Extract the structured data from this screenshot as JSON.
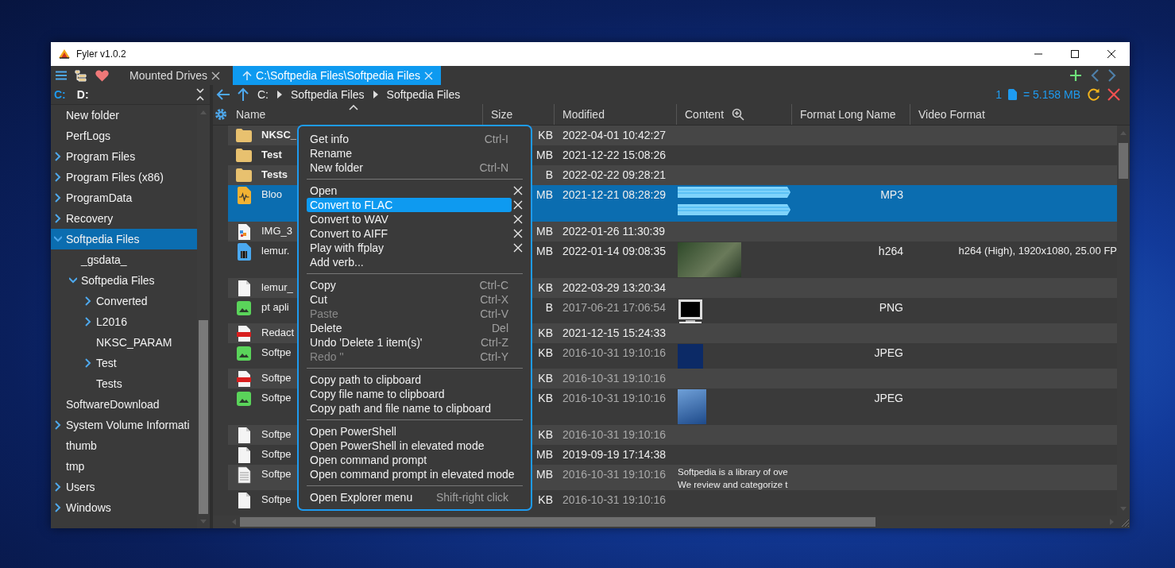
{
  "window": {
    "title": "Fyler v1.0.2"
  },
  "tabs": [
    {
      "label": "Mounted Drives",
      "selected": false
    },
    {
      "label": "C:\\Softpedia Files\\Softpedia Files",
      "selected": true
    }
  ],
  "drives": [
    {
      "label": "C:",
      "selected": true
    },
    {
      "label": "D:",
      "selected": false
    }
  ],
  "breadcrumb": [
    "C:",
    "Softpedia Files",
    "Softpedia Files"
  ],
  "selection_summary": {
    "count": "1",
    "size": "= 5.158 MB"
  },
  "tree": [
    {
      "label": "New folder",
      "expandable": false,
      "selected": false
    },
    {
      "label": "PerfLogs",
      "expandable": false,
      "selected": false
    },
    {
      "label": "Program Files",
      "expandable": true,
      "expanded": false,
      "selected": false
    },
    {
      "label": "Program Files (x86)",
      "expandable": true,
      "expanded": false,
      "selected": false
    },
    {
      "label": "ProgramData",
      "expandable": true,
      "expanded": false,
      "selected": false
    },
    {
      "label": "Recovery",
      "expandable": true,
      "expanded": false,
      "selected": false
    },
    {
      "label": "Softpedia Files",
      "expandable": true,
      "expanded": true,
      "selected": true,
      "children": [
        {
          "label": "_gsdata_",
          "expandable": false,
          "selected": false
        },
        {
          "label": "Softpedia Files",
          "expandable": true,
          "expanded": true,
          "selected": false,
          "children": [
            {
              "label": "Converted",
              "expandable": true,
              "expanded": false,
              "selected": false
            },
            {
              "label": "L2016",
              "expandable": true,
              "expanded": false,
              "selected": false
            },
            {
              "label": "NKSC_PARAM",
              "expandable": false,
              "selected": false
            },
            {
              "label": "Test",
              "expandable": true,
              "expanded": false,
              "selected": false
            },
            {
              "label": "Tests",
              "expandable": false,
              "selected": false
            }
          ]
        }
      ]
    },
    {
      "label": "SoftwareDownload",
      "expandable": false,
      "selected": false
    },
    {
      "label": "System Volume Informati",
      "expandable": true,
      "expanded": false,
      "selected": false
    },
    {
      "label": "thumb",
      "expandable": false,
      "selected": false
    },
    {
      "label": "tmp",
      "expandable": false,
      "selected": false
    },
    {
      "label": "Users",
      "expandable": true,
      "expanded": false,
      "selected": false
    },
    {
      "label": "Windows",
      "expandable": true,
      "expanded": false,
      "selected": false
    }
  ],
  "columns": [
    {
      "label": "Name",
      "kind": "plain"
    },
    {
      "label": "Size",
      "kind": "plain"
    },
    {
      "label": "Modified",
      "kind": "plain"
    },
    {
      "label": "Content",
      "kind": "zoomable"
    },
    {
      "label": "Format Long Name",
      "kind": "plain"
    },
    {
      "label": "Video Format",
      "kind": "plain"
    }
  ],
  "rows": [
    {
      "kind": "folder",
      "name": "NKSC_",
      "size": "KB",
      "modified": "2022-04-01 10:42:27",
      "dimmed": false,
      "selected": false
    },
    {
      "kind": "folder",
      "name": "Test",
      "size": "MB",
      "modified": "2021-12-22 15:08:26",
      "dimmed": false,
      "selected": false
    },
    {
      "kind": "folder",
      "name": "Tests",
      "size": "B",
      "modified": "2022-02-22 09:28:21",
      "dimmed": false,
      "selected": false
    },
    {
      "kind": "audio",
      "name": "Bloo",
      "size": "MB",
      "modified": "2021-12-21 08:28:29",
      "dimmed": false,
      "selected": true,
      "content": {
        "kind": "waveform"
      },
      "format": "MP3"
    },
    {
      "kind": "image",
      "name": "IMG_3",
      "size": "MB",
      "modified": "2022-01-26 11:30:39",
      "dimmed": false,
      "selected": false
    },
    {
      "kind": "video",
      "name": "lemur.",
      "size": "MB",
      "modified": "2022-01-14 09:08:35",
      "dimmed": false,
      "selected": false,
      "content": {
        "kind": "photo"
      },
      "format": "h264",
      "video_format": "h264 (High), 1920x1080, 25.00 FP"
    },
    {
      "kind": "document",
      "name": "lemur_",
      "size": "KB",
      "modified": "2022-03-29 13:20:34",
      "dimmed": false,
      "selected": false
    },
    {
      "kind": "picture",
      "name": "pt apli",
      "size": "B",
      "modified": "2017-06-21 17:06:54",
      "dimmed": true,
      "selected": false,
      "content": {
        "kind": "monitor"
      },
      "format": "PNG"
    },
    {
      "kind": "pdf",
      "name": "Redact",
      "size": "KB",
      "modified": "2021-12-15 15:24:33",
      "dimmed": false,
      "selected": false
    },
    {
      "kind": "picture",
      "name": "Softpe",
      "size": "KB",
      "modified": "2016-10-31 19:10:16",
      "dimmed": true,
      "selected": false,
      "content": {
        "kind": "logo"
      },
      "format": "JPEG"
    },
    {
      "kind": "pdf",
      "name": "Softpe",
      "size": "KB",
      "modified": "2016-10-31 19:10:16",
      "dimmed": true,
      "selected": false
    },
    {
      "kind": "picture",
      "name": "Softpe",
      "size": "KB",
      "modified": "2016-10-31 19:10:16",
      "dimmed": true,
      "selected": false,
      "content": {
        "kind": "logo-large"
      },
      "format": "JPEG"
    },
    {
      "kind": "document",
      "name": "Softpe",
      "size": "KB",
      "modified": "2016-10-31 19:10:16",
      "dimmed": true,
      "selected": false
    },
    {
      "kind": "document",
      "name": "Softpe",
      "size": "MB",
      "modified": "2019-09-19 17:14:38",
      "dimmed": false,
      "selected": false
    },
    {
      "kind": "text",
      "name": "Softpe",
      "size": "MB",
      "modified": "2016-10-31 19:10:16",
      "dimmed": true,
      "selected": false,
      "content": {
        "kind": "text",
        "lines": [
          "Softpedia is a library of ove",
          "We review and categorize t"
        ]
      }
    },
    {
      "kind": "document",
      "name": "Softpe",
      "size": "KB",
      "modified": "2016-10-31 19:10:16",
      "dimmed": true,
      "selected": false
    }
  ],
  "context_menu": {
    "groups": [
      [
        {
          "label": "Get info",
          "shortcut": "Ctrl-I",
          "disabled": false,
          "selected": false,
          "removable": false
        },
        {
          "label": "Rename",
          "disabled": false,
          "selected": false,
          "removable": false
        },
        {
          "label": "New folder",
          "shortcut": "Ctrl-N",
          "disabled": false,
          "selected": false,
          "removable": false
        }
      ],
      [
        {
          "label": "Open",
          "disabled": false,
          "selected": false,
          "removable": true
        },
        {
          "label": "Convert to FLAC",
          "disabled": false,
          "selected": true,
          "removable": true
        },
        {
          "label": "Convert to WAV",
          "disabled": false,
          "selected": false,
          "removable": true
        },
        {
          "label": "Convert to AIFF",
          "disabled": false,
          "selected": false,
          "removable": true
        },
        {
          "label": "Play with ffplay",
          "disabled": false,
          "selected": false,
          "removable": true
        },
        {
          "label": "Add verb...",
          "disabled": false,
          "selected": false,
          "removable": false
        }
      ],
      [
        {
          "label": "Copy",
          "shortcut": "Ctrl-C",
          "disabled": false,
          "selected": false,
          "removable": false
        },
        {
          "label": "Cut",
          "shortcut": "Ctrl-X",
          "disabled": false,
          "selected": false,
          "removable": false
        },
        {
          "label": "Paste",
          "shortcut": "Ctrl-V",
          "disabled": true,
          "selected": false,
          "removable": false
        },
        {
          "label": "Delete",
          "shortcut": "Del",
          "disabled": false,
          "selected": false,
          "removable": false
        },
        {
          "label": "Undo 'Delete 1 item(s)'",
          "shortcut": "Ctrl-Z",
          "disabled": false,
          "selected": false,
          "removable": false
        },
        {
          "label": "Redo ''",
          "shortcut": "Ctrl-Y",
          "disabled": true,
          "selected": false,
          "removable": false
        }
      ],
      [
        {
          "label": "Copy path to clipboard",
          "disabled": false,
          "selected": false,
          "removable": false
        },
        {
          "label": "Copy file name to clipboard",
          "disabled": false,
          "selected": false,
          "removable": false
        },
        {
          "label": "Copy path and file name to clipboard",
          "disabled": false,
          "selected": false,
          "removable": false
        }
      ],
      [
        {
          "label": "Open PowerShell",
          "disabled": false,
          "selected": false,
          "removable": false
        },
        {
          "label": "Open PowerShell in elevated mode",
          "disabled": false,
          "selected": false,
          "removable": false
        },
        {
          "label": "Open command prompt",
          "disabled": false,
          "selected": false,
          "removable": false
        },
        {
          "label": "Open command prompt in elevated mode",
          "disabled": false,
          "selected": false,
          "removable": false
        }
      ],
      [
        {
          "label": "Open Explorer menu",
          "shortcut": "Shift-right click",
          "disabled": false,
          "selected": false,
          "removable": false
        }
      ]
    ]
  }
}
